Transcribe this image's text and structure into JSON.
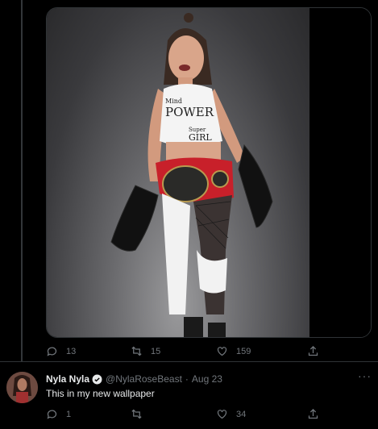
{
  "media_tweet": {
    "photo_text": {
      "line1": "Mind",
      "line2": "POWER",
      "line3": "Super",
      "line4": "GIRL"
    },
    "actions": {
      "replies": "13",
      "retweets": "15",
      "likes": "159"
    }
  },
  "reply_tweet": {
    "display_name": "Nyla Nyla",
    "handle": "@NylaRoseBeast",
    "separator": "·",
    "date": "Aug 23",
    "text": "This in my new wallpaper",
    "more": "···",
    "actions": {
      "replies": "1",
      "retweets": "",
      "likes": "34"
    }
  },
  "colors": {
    "background": "#000000",
    "text": "#e7e9ea",
    "secondary_text": "#71767b",
    "border": "#2f3336",
    "verified": "#1d9bf0"
  },
  "icons": [
    "reply-icon",
    "retweet-icon",
    "like-icon",
    "share-icon",
    "verified-badge-icon",
    "more-icon"
  ]
}
